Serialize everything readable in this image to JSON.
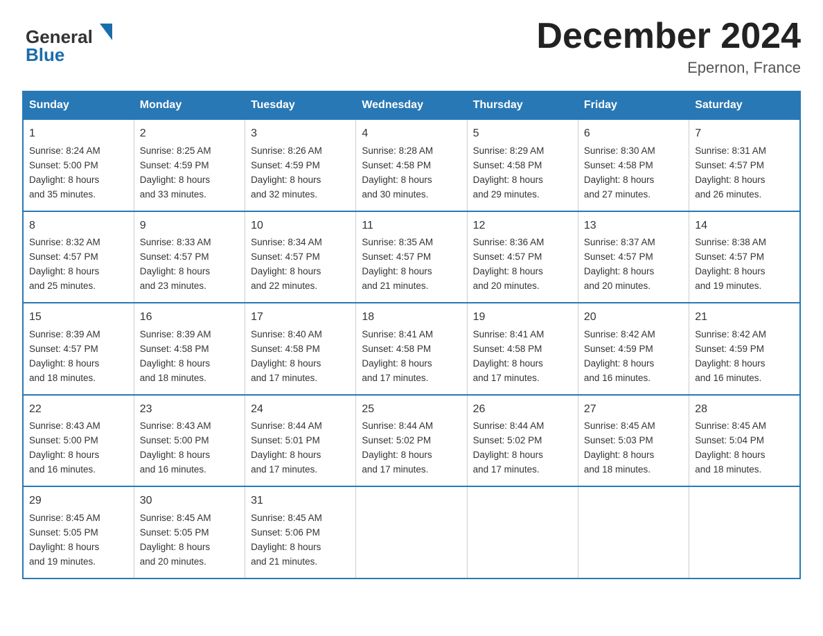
{
  "header": {
    "logo_line1": "General",
    "logo_line2": "Blue",
    "title": "December 2024",
    "subtitle": "Epernon, France"
  },
  "days": [
    "Sunday",
    "Monday",
    "Tuesday",
    "Wednesday",
    "Thursday",
    "Friday",
    "Saturday"
  ],
  "weeks": [
    [
      {
        "day": "1",
        "sunrise": "8:24 AM",
        "sunset": "5:00 PM",
        "daylight": "8 hours and 35 minutes."
      },
      {
        "day": "2",
        "sunrise": "8:25 AM",
        "sunset": "4:59 PM",
        "daylight": "8 hours and 33 minutes."
      },
      {
        "day": "3",
        "sunrise": "8:26 AM",
        "sunset": "4:59 PM",
        "daylight": "8 hours and 32 minutes."
      },
      {
        "day": "4",
        "sunrise": "8:28 AM",
        "sunset": "4:58 PM",
        "daylight": "8 hours and 30 minutes."
      },
      {
        "day": "5",
        "sunrise": "8:29 AM",
        "sunset": "4:58 PM",
        "daylight": "8 hours and 29 minutes."
      },
      {
        "day": "6",
        "sunrise": "8:30 AM",
        "sunset": "4:58 PM",
        "daylight": "8 hours and 27 minutes."
      },
      {
        "day": "7",
        "sunrise": "8:31 AM",
        "sunset": "4:57 PM",
        "daylight": "8 hours and 26 minutes."
      }
    ],
    [
      {
        "day": "8",
        "sunrise": "8:32 AM",
        "sunset": "4:57 PM",
        "daylight": "8 hours and 25 minutes."
      },
      {
        "day": "9",
        "sunrise": "8:33 AM",
        "sunset": "4:57 PM",
        "daylight": "8 hours and 23 minutes."
      },
      {
        "day": "10",
        "sunrise": "8:34 AM",
        "sunset": "4:57 PM",
        "daylight": "8 hours and 22 minutes."
      },
      {
        "day": "11",
        "sunrise": "8:35 AM",
        "sunset": "4:57 PM",
        "daylight": "8 hours and 21 minutes."
      },
      {
        "day": "12",
        "sunrise": "8:36 AM",
        "sunset": "4:57 PM",
        "daylight": "8 hours and 20 minutes."
      },
      {
        "day": "13",
        "sunrise": "8:37 AM",
        "sunset": "4:57 PM",
        "daylight": "8 hours and 20 minutes."
      },
      {
        "day": "14",
        "sunrise": "8:38 AM",
        "sunset": "4:57 PM",
        "daylight": "8 hours and 19 minutes."
      }
    ],
    [
      {
        "day": "15",
        "sunrise": "8:39 AM",
        "sunset": "4:57 PM",
        "daylight": "8 hours and 18 minutes."
      },
      {
        "day": "16",
        "sunrise": "8:39 AM",
        "sunset": "4:58 PM",
        "daylight": "8 hours and 18 minutes."
      },
      {
        "day": "17",
        "sunrise": "8:40 AM",
        "sunset": "4:58 PM",
        "daylight": "8 hours and 17 minutes."
      },
      {
        "day": "18",
        "sunrise": "8:41 AM",
        "sunset": "4:58 PM",
        "daylight": "8 hours and 17 minutes."
      },
      {
        "day": "19",
        "sunrise": "8:41 AM",
        "sunset": "4:58 PM",
        "daylight": "8 hours and 17 minutes."
      },
      {
        "day": "20",
        "sunrise": "8:42 AM",
        "sunset": "4:59 PM",
        "daylight": "8 hours and 16 minutes."
      },
      {
        "day": "21",
        "sunrise": "8:42 AM",
        "sunset": "4:59 PM",
        "daylight": "8 hours and 16 minutes."
      }
    ],
    [
      {
        "day": "22",
        "sunrise": "8:43 AM",
        "sunset": "5:00 PM",
        "daylight": "8 hours and 16 minutes."
      },
      {
        "day": "23",
        "sunrise": "8:43 AM",
        "sunset": "5:00 PM",
        "daylight": "8 hours and 16 minutes."
      },
      {
        "day": "24",
        "sunrise": "8:44 AM",
        "sunset": "5:01 PM",
        "daylight": "8 hours and 17 minutes."
      },
      {
        "day": "25",
        "sunrise": "8:44 AM",
        "sunset": "5:02 PM",
        "daylight": "8 hours and 17 minutes."
      },
      {
        "day": "26",
        "sunrise": "8:44 AM",
        "sunset": "5:02 PM",
        "daylight": "8 hours and 17 minutes."
      },
      {
        "day": "27",
        "sunrise": "8:45 AM",
        "sunset": "5:03 PM",
        "daylight": "8 hours and 18 minutes."
      },
      {
        "day": "28",
        "sunrise": "8:45 AM",
        "sunset": "5:04 PM",
        "daylight": "8 hours and 18 minutes."
      }
    ],
    [
      {
        "day": "29",
        "sunrise": "8:45 AM",
        "sunset": "5:05 PM",
        "daylight": "8 hours and 19 minutes."
      },
      {
        "day": "30",
        "sunrise": "8:45 AM",
        "sunset": "5:05 PM",
        "daylight": "8 hours and 20 minutes."
      },
      {
        "day": "31",
        "sunrise": "8:45 AM",
        "sunset": "5:06 PM",
        "daylight": "8 hours and 21 minutes."
      },
      null,
      null,
      null,
      null
    ]
  ],
  "labels": {
    "sunrise": "Sunrise:",
    "sunset": "Sunset:",
    "daylight": "Daylight:"
  }
}
